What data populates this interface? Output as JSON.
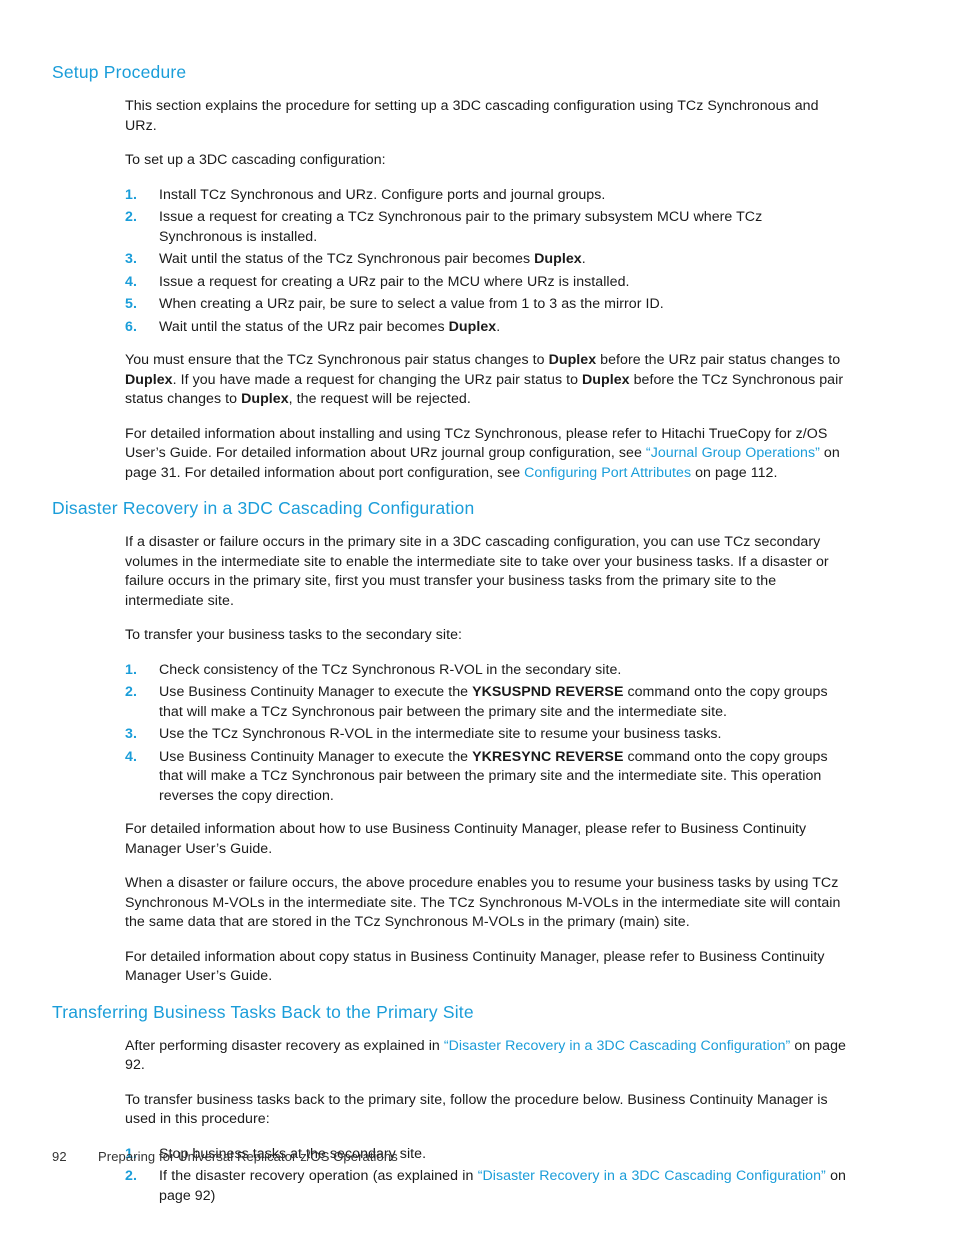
{
  "colors": {
    "heading": "#1a9dd9",
    "link": "#1a9dd9",
    "marker": "#1a9dd9",
    "body_text": "#1a1a1a",
    "background": "#ffffff"
  },
  "sections": [
    {
      "id": "setup-procedure",
      "heading": "Setup Procedure",
      "intro_paragraphs": [
        "This section explains the procedure for setting up a 3DC cascading configuration using TCz Synchronous and URz.",
        "To set up a 3DC cascading configuration:"
      ],
      "steps": [
        {
          "num": "1.",
          "parts": [
            {
              "t": "Install TCz Synchronous and URz.  Configure ports and journal groups.",
              "s": "normal"
            }
          ]
        },
        {
          "num": "2.",
          "parts": [
            {
              "t": "Issue a request for creating a TCz Synchronous pair to the primary subsystem MCU where TCz Synchronous is installed.",
              "s": "normal"
            }
          ]
        },
        {
          "num": "3.",
          "parts": [
            {
              "t": "Wait until the status of the TCz Synchronous pair becomes ",
              "s": "normal"
            },
            {
              "t": "Duplex",
              "s": "bold"
            },
            {
              "t": ".",
              "s": "normal"
            }
          ]
        },
        {
          "num": "4.",
          "parts": [
            {
              "t": "Issue a request for creating a URz pair to the MCU where URz is installed.",
              "s": "normal"
            }
          ]
        },
        {
          "num": "5.",
          "parts": [
            {
              "t": "When creating a URz pair, be sure to select a value from 1 to 3 as the mirror ID.",
              "s": "normal"
            }
          ]
        },
        {
          "num": "6.",
          "parts": [
            {
              "t": "Wait until the status of the URz pair becomes ",
              "s": "normal"
            },
            {
              "t": "Duplex",
              "s": "bold"
            },
            {
              "t": ".",
              "s": "normal"
            }
          ]
        }
      ],
      "outro_paragraphs": [
        {
          "parts": [
            {
              "t": "You must ensure that the TCz Synchronous pair status changes to ",
              "s": "normal"
            },
            {
              "t": "Duplex",
              "s": "bold"
            },
            {
              "t": " before the URz pair status changes to ",
              "s": "normal"
            },
            {
              "t": "Duplex",
              "s": "bold"
            },
            {
              "t": ".  If you have made a request for changing the URz pair status to ",
              "s": "normal"
            },
            {
              "t": "Duplex",
              "s": "bold"
            },
            {
              "t": " before the TCz Synchronous pair status changes to ",
              "s": "normal"
            },
            {
              "t": "Duplex",
              "s": "bold"
            },
            {
              "t": ", the request will be rejected.",
              "s": "normal"
            }
          ]
        },
        {
          "parts": [
            {
              "t": "For detailed information about installing and using TCz Synchronous, please refer to Hitachi TrueCopy for z/OS User’s Guide.  For detailed information about URz journal group configuration, see ",
              "s": "normal"
            },
            {
              "t": "“Journal Group Operations”",
              "s": "link"
            },
            {
              "t": " on page 31.  For detailed information about port configuration, see ",
              "s": "normal"
            },
            {
              "t": "Configuring Port Attributes",
              "s": "link"
            },
            {
              "t": " on page 112.",
              "s": "normal"
            }
          ]
        }
      ]
    },
    {
      "id": "disaster-recovery-3dc",
      "heading": "Disaster Recovery in a 3DC Cascading Configuration",
      "intro_paragraphs": [
        "If a disaster or failure occurs in the primary site in a 3DC cascading configuration, you can use TCz secondary volumes in the intermediate site to enable the intermediate site to take over your business tasks.  If a disaster or failure occurs in the primary site, first you must transfer your business tasks from the primary site to the intermediate site.",
        "To transfer your business tasks to the secondary site:"
      ],
      "steps": [
        {
          "num": "1.",
          "parts": [
            {
              "t": "Check consistency of the TCz Synchronous R-VOL in the secondary site.",
              "s": "normal"
            }
          ]
        },
        {
          "num": "2.",
          "parts": [
            {
              "t": "Use Business Continuity Manager to execute the ",
              "s": "normal"
            },
            {
              "t": "YKSUSPND REVERSE",
              "s": "bold"
            },
            {
              "t": " command onto the copy groups that will make a TCz Synchronous pair between the primary site and the intermediate site.",
              "s": "normal"
            }
          ]
        },
        {
          "num": "3.",
          "parts": [
            {
              "t": "Use the TCz Synchronous R-VOL in the intermediate site to resume your business tasks.",
              "s": "normal"
            }
          ]
        },
        {
          "num": "4.",
          "parts": [
            {
              "t": "Use Business Continuity Manager to execute the ",
              "s": "normal"
            },
            {
              "t": "YKRESYNC REVERSE",
              "s": "bold"
            },
            {
              "t": " command onto the copy groups that will make a TCz Synchronous pair between the primary site and the intermediate site.  This operation reverses the copy direction.",
              "s": "normal"
            }
          ]
        }
      ],
      "outro_paragraphs": [
        {
          "parts": [
            {
              "t": "For detailed information about how to use Business Continuity Manager, please refer to Business Continuity Manager User’s Guide.",
              "s": "normal"
            }
          ]
        },
        {
          "parts": [
            {
              "t": "When a disaster or failure occurs, the above procedure enables you to resume your business tasks by using TCz Synchronous M-VOLs in the intermediate site.  The TCz Synchronous M-VOLs in the intermediate site will contain the same data that are stored in the TCz Synchronous M-VOLs in the primary (main) site.",
              "s": "normal"
            }
          ]
        },
        {
          "parts": [
            {
              "t": "For detailed information about copy status in Business Continuity Manager, please refer to Business Continuity Manager User’s Guide.",
              "s": "normal"
            }
          ]
        }
      ]
    },
    {
      "id": "transferring-back",
      "heading": "Transferring Business Tasks Back to the Primary Site",
      "intro_paragraphs_rich": [
        {
          "justify": true,
          "parts": [
            {
              "t": "After performing disaster recovery as explained in ",
              "s": "normal"
            },
            {
              "t": "“Disaster Recovery in a 3DC Cascading Configuration”",
              "s": "link"
            },
            {
              "t": " on page 92.",
              "s": "normal"
            }
          ]
        },
        {
          "justify": false,
          "parts": [
            {
              "t": "To transfer business tasks back to the primary site, follow the procedure below.  Business Continuity Manager is used in this procedure:",
              "s": "normal"
            }
          ]
        }
      ],
      "steps": [
        {
          "num": "1.",
          "justify": false,
          "parts": [
            {
              "t": "Stop business tasks at the secondary site.",
              "s": "normal"
            }
          ]
        },
        {
          "num": "2.",
          "justify": true,
          "parts": [
            {
              "t": "If the disaster recovery operation (as explained in ",
              "s": "normal"
            },
            {
              "t": "“Disaster Recovery in a 3DC Cascading Configuration”",
              "s": "link"
            },
            {
              "t": " on page 92)",
              "s": "normal"
            }
          ]
        }
      ]
    }
  ],
  "footer": {
    "page_number": "92",
    "running_title": "Preparing for Universal Replicator z/OS Operations"
  }
}
